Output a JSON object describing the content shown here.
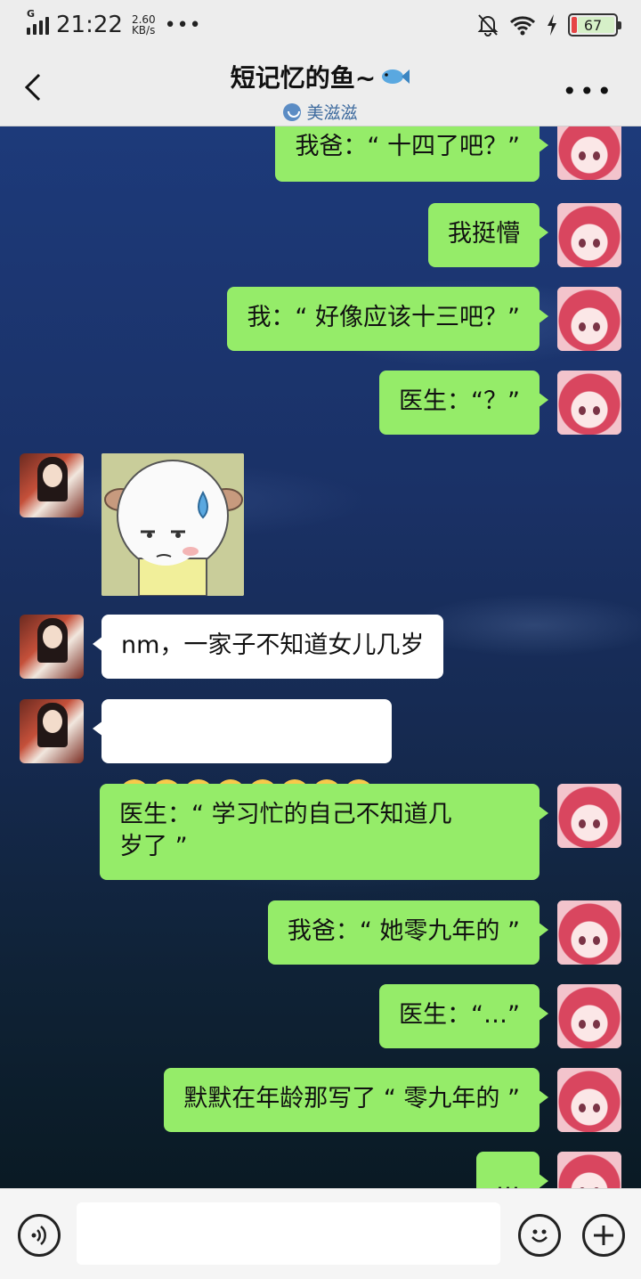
{
  "status_bar": {
    "network": "G",
    "time": "21:22",
    "speed_value": "2.60",
    "speed_unit": "KB/s",
    "more": "•••",
    "battery": "67"
  },
  "header": {
    "title": "短记忆的鱼~",
    "subtitle": "美滋滋",
    "more": "•••"
  },
  "messages": [
    {
      "side": "me",
      "text": "我爸：“ 十四了吧？”"
    },
    {
      "side": "me",
      "text": "我挺懵"
    },
    {
      "side": "me",
      "text": "我：“ 好像应该十三吧？”"
    },
    {
      "side": "me",
      "text": "医生：“？”"
    },
    {
      "side": "other",
      "type": "sticker",
      "sticker": "sweating-sheep-sticker"
    },
    {
      "side": "other",
      "text": "nm，一家子不知道女儿几岁"
    },
    {
      "side": "other",
      "type": "emoji",
      "emojis": [
        "sad",
        "sad",
        "sad",
        "grin",
        "grin",
        "grin",
        "grin",
        "grin"
      ]
    },
    {
      "side": "me",
      "text": "医生：“ 学习忙的自己不知道几\n岁了 ”"
    },
    {
      "side": "me",
      "text": "我爸：“ 她零九年的 ”"
    },
    {
      "side": "me",
      "text": "医生：“…”"
    },
    {
      "side": "me",
      "text": "默默在年龄那写了 “ 零九年的 ”"
    },
    {
      "side": "me",
      "text": "…"
    }
  ],
  "input": {
    "placeholder": ""
  },
  "colors": {
    "my_bubble": "#95ec69",
    "other_bubble": "#ffffff",
    "bar_bg": "#ededed"
  }
}
